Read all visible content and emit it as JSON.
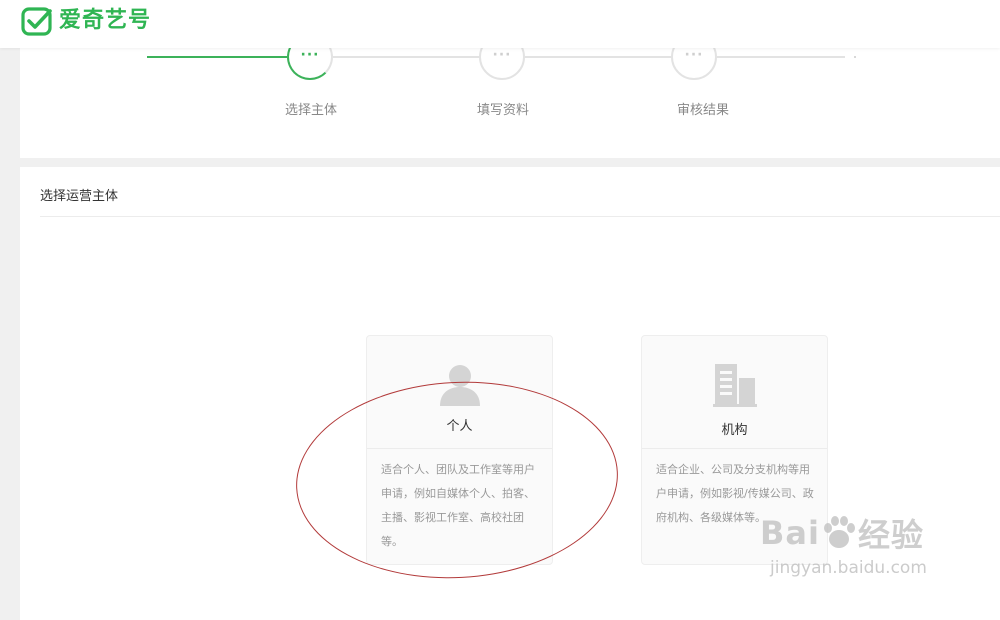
{
  "header": {
    "brand": "爱奇艺号"
  },
  "steps": [
    {
      "label": "选择主体",
      "marker": "···",
      "active": true
    },
    {
      "label": "填写资料",
      "marker": "···",
      "active": false
    },
    {
      "label": "审核结果",
      "marker": "···",
      "active": false
    }
  ],
  "main": {
    "section_title": "选择运营主体",
    "options": [
      {
        "title": "个人",
        "icon": "person-icon",
        "description": "适合个人、团队及工作室等用户申请，例如自媒体个人、拍客、主播、影视工作室、高校社团等。"
      },
      {
        "title": "机构",
        "icon": "building-icon",
        "description": "适合企业、公司及分支机构等用户申请，例如影视/传媒公司、政府机构、各级媒体等。"
      }
    ]
  },
  "watermark": {
    "main_left": "Bai",
    "main_right": "经验",
    "sub": "jingyan.baidu.com"
  },
  "colors": {
    "brand_green": "#2fb553",
    "annotation_red": "#b23a3a"
  }
}
